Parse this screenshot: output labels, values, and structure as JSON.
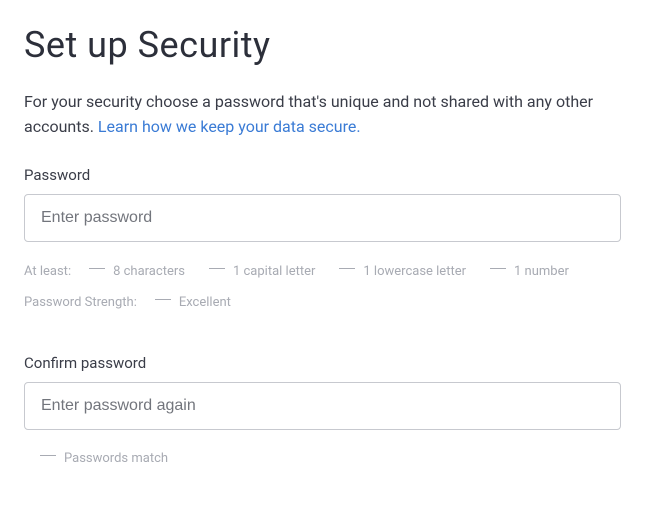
{
  "page": {
    "title": "Set up Security",
    "intro_text": "For your security choose a password that's unique and not shared with any other accounts. ",
    "intro_link": "Learn how we keep your data secure."
  },
  "password": {
    "label": "Password",
    "placeholder": "Enter password"
  },
  "requirements": {
    "at_least_label": "At least:",
    "items": {
      "chars": "8 characters",
      "capital": "1 capital letter",
      "lowercase": "1 lowercase letter",
      "number": "1 number"
    },
    "strength_label": "Password Strength:",
    "strength_value": "Excellent"
  },
  "confirm": {
    "label": "Confirm password",
    "placeholder": "Enter password again",
    "match_text": "Passwords match"
  }
}
